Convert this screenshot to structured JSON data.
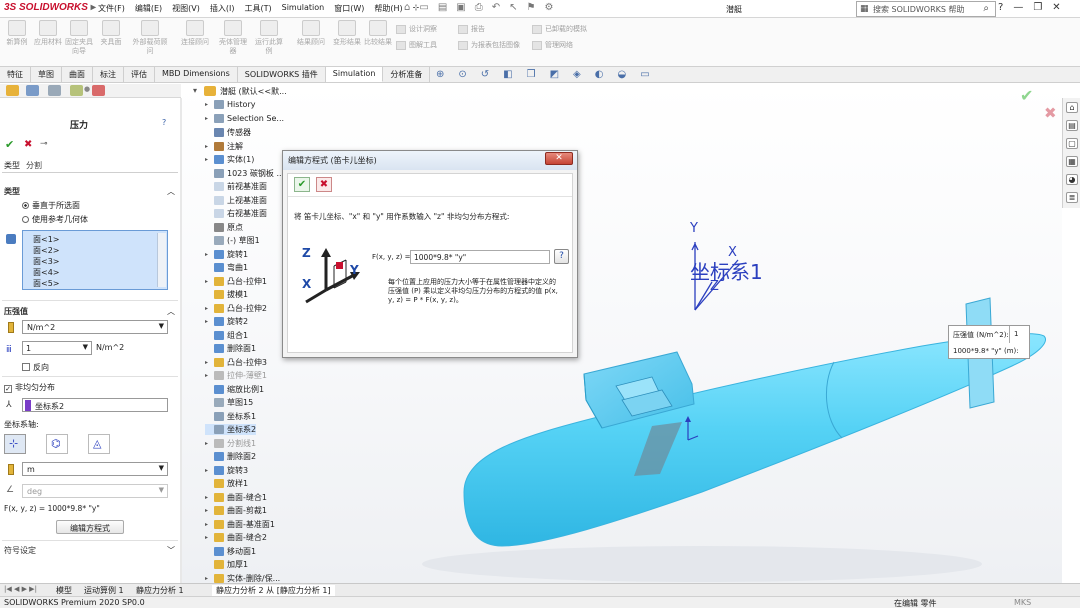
{
  "app": {
    "logo": "SOLIDWORKS",
    "menus": [
      "文件(F)",
      "编辑(E)",
      "视图(V)",
      "插入(I)",
      "工具(T)",
      "Simulation",
      "窗口(W)",
      "帮助(H)"
    ],
    "document_title": "潜艇",
    "search_placeholder": "搜索 SOLIDWORKS 帮助"
  },
  "command_manager": {
    "buttons": [
      "新算例",
      "应用材料",
      "固定夹具向导",
      "夹具面",
      "外部载荷顾问",
      "连接顾问",
      "壳体管理器",
      "运行此算例",
      "结果顾问",
      "变形结果",
      "比较结果"
    ],
    "small_items": [
      "设计洞察",
      "图解工具",
      "报告",
      "为报表包括图像",
      "已卸载的模拟",
      "管理网络"
    ]
  },
  "tabs": [
    "特征",
    "草图",
    "曲面",
    "标注",
    "评估",
    "MBD Dimensions",
    "SOLIDWORKS 插件",
    "Simulation",
    "分析准备"
  ],
  "active_tab": "Simulation",
  "property_manager": {
    "title": "压力",
    "subtabs": [
      "类型",
      "分割"
    ],
    "type_section": "类型",
    "option_normal": "垂直于所选面",
    "option_ref": "使用参考几何体",
    "faces": [
      "面<1>",
      "面<2>",
      "面<3>",
      "面<4>",
      "面<5>"
    ],
    "pressure_section": "压强值",
    "unit_value": "N/m^2",
    "pressure_value": "1",
    "pressure_unit_suffix": "N/m^2",
    "reverse_label": "反向",
    "nonuniform_label": "非均匀分布",
    "coord_system": "坐标系2",
    "axes_label": "坐标系轴:",
    "length_unit": "m",
    "angle_unit": "deg",
    "formula": "F(x, y, z) = 1000*9.8* \"y\"",
    "edit_equation_button": "编辑方程式",
    "symbol_settings": "符号设定"
  },
  "tree": {
    "root": "潜艇 (默认<<默...",
    "items": [
      "History",
      "Selection Se...",
      "传感器",
      "注解",
      "实体(1)",
      "1023 碳钢板 ...",
      "前视基准面",
      "上视基准面",
      "右视基准面",
      "原点",
      "(-) 草图1",
      "旋转1",
      "弯曲1",
      "凸台-拉伸1",
      "拔模1",
      "凸台-拉伸2",
      "旋转2",
      "组合1",
      "删除面1",
      "凸台-拉伸3",
      "拉伸-薄壁1",
      "缩放比例1",
      "草图15",
      "坐标系1",
      "坐标系2",
      "分割线1",
      "删除面2",
      "旋转3",
      "放样1",
      "曲面-缝合1",
      "曲面-剪裁1",
      "曲面-基准面1",
      "曲面-缝合2",
      "移动面1",
      "加厚1",
      "实体-删除/保..."
    ]
  },
  "dialog": {
    "title": "编辑方程式 (笛卡儿坐标)",
    "instruction": "将 笛卡儿坐标、\"x\" 和 \"y\" 用作系数输入 \"z\" 非均匀分布方程式:",
    "field_label": "F(x, y, z) =",
    "field_value": "1000*9.8* \"y\"",
    "description": "每个位置上应用的压力大小等于在属性管理器中定义的压强值 (P) 乘以定义非均匀压力分布的方程式的值 p(x, y, z) = P * F(x, y, z)。",
    "axis_z": "Z",
    "axis_y": "Y",
    "axis_x": "X"
  },
  "viewport": {
    "coord_label": "坐标系1",
    "axis_y": "Y",
    "axis_x": "X",
    "axis_z": "Z",
    "callout_label1": "压强值 (N/m^2):",
    "callout_value1": "1",
    "callout_label2": "1000*9.8* \"y\" (m):"
  },
  "bottom_tabs": [
    "模型",
    "运动算例 1",
    "静应力分析 1",
    "静应力分析 2 从 [静应力分析 1]"
  ],
  "status": {
    "left": "SOLIDWORKS Premium 2020 SP0.0",
    "mode": "在编辑 零件",
    "units": "MKS"
  },
  "colors": {
    "hull": "#55d2f5",
    "coord_blue": "#2b3fbf",
    "selection_blue": "#cfe3fb",
    "accent_red": "#c8102e"
  }
}
